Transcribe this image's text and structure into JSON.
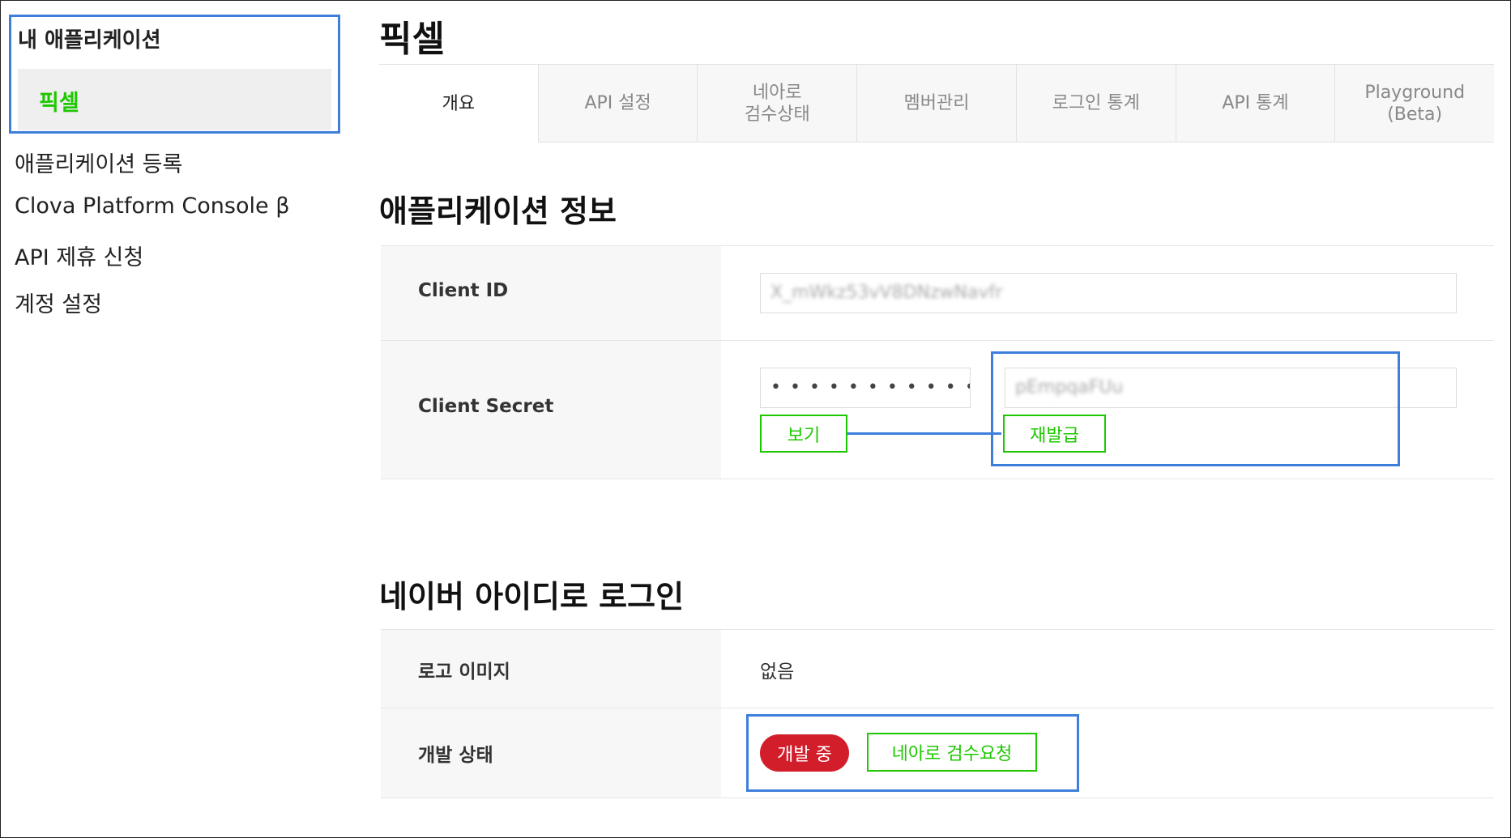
{
  "sidebar": {
    "app_section_title": "내 애플리케이션",
    "selected_app": "픽셀",
    "links": [
      "애플리케이션 등록",
      "Clova Platform Console β",
      "API 제휴 신청",
      "계정 설정"
    ]
  },
  "page": {
    "title": "픽셀"
  },
  "tabs": [
    "개요",
    "API 설정",
    "네아로\n검수상태",
    "멤버관리",
    "로그인 통계",
    "API 통계",
    "Playground (Beta)"
  ],
  "app_info": {
    "title": "애플리케이션 정보",
    "client_id_label": "Client ID",
    "client_id_value": "X_mWkz53vV8DNzwNavfr",
    "client_secret_label": "Client Secret",
    "secret_masked": "• • • • • • • • • • •",
    "secret_value": "pEmpqaFUu",
    "view_button": "보기",
    "reissue_button": "재발급"
  },
  "naver_login": {
    "title": "네이버 아이디로 로그인",
    "logo_label": "로고 이미지",
    "logo_value": "없음",
    "status_label": "개발 상태",
    "status_badge": "개발 중",
    "review_button": "네아로 검수요청"
  },
  "colors": {
    "accent_green": "#1ec800",
    "highlight_blue": "#3d7fdb",
    "status_red": "#d21e2b"
  }
}
